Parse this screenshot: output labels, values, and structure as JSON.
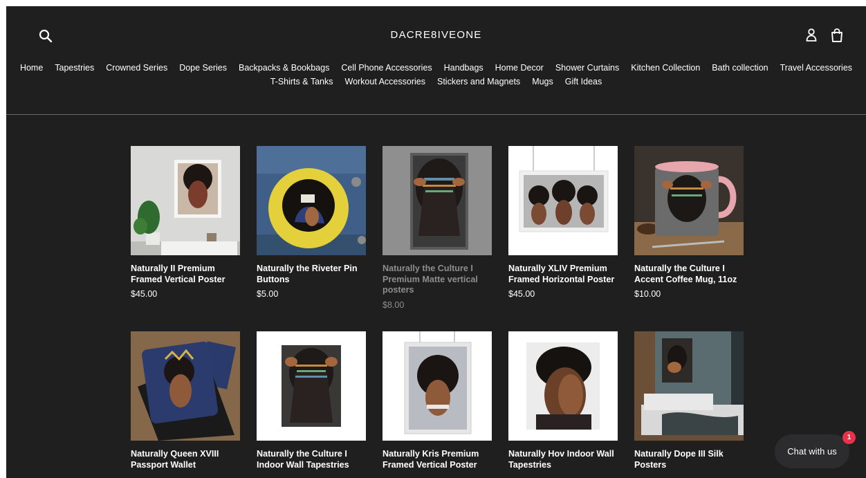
{
  "brand": {
    "logo_text": "DACRE8IVEONE"
  },
  "header_icons": [
    "search-icon",
    "account-icon",
    "cart-icon"
  ],
  "nav": {
    "row1": [
      "Home",
      "Tapestries",
      "Crowned Series",
      "Dope Series",
      "Backpacks & Bookbags",
      "Cell Phone Accessories",
      "Handbags",
      "Home Decor",
      "Shower Curtains",
      "Kitchen Collection",
      "Bath collection",
      "Travel Accessories"
    ],
    "row2": [
      "T-Shirts & Tanks",
      "Workout Accessories",
      "Stickers and Magnets",
      "Mugs",
      "Gift Ideas"
    ]
  },
  "products": [
    {
      "title": "Naturally II Premium Framed Vertical Poster",
      "price": "$45.00",
      "muted": false
    },
    {
      "title": "Naturally the Riveter Pin Buttons",
      "price": "$5.00",
      "muted": false
    },
    {
      "title": "Naturally the Culture I Premium Matte vertical posters",
      "price": "$8.00",
      "muted": true
    },
    {
      "title": "Naturally XLIV Premium Framed Horizontal Poster",
      "price": "$45.00",
      "muted": false
    },
    {
      "title": "Naturally the Culture I Accent Coffee Mug, 11oz",
      "price": "$10.00",
      "muted": false
    },
    {
      "title": "Naturally Queen XVIII Passport Wallet",
      "price": "",
      "muted": false
    },
    {
      "title": "Naturally the Culture I Indoor Wall Tapestries",
      "price": "",
      "muted": false
    },
    {
      "title": "Naturally Kris Premium Framed Vertical Poster",
      "price": "",
      "muted": false
    },
    {
      "title": "Naturally Hov Indoor Wall Tapestries",
      "price": "",
      "muted": false
    },
    {
      "title": "Naturally Dope III Silk Posters",
      "price": "",
      "muted": false
    }
  ],
  "chat": {
    "label": "Chat with us",
    "badge": "1"
  },
  "colors": {
    "background": "#1f1f1f",
    "text": "#ffffff",
    "muted_text": "#8d8d8d",
    "badge": "#e8314a",
    "chat_bg": "#2c2c2e"
  }
}
